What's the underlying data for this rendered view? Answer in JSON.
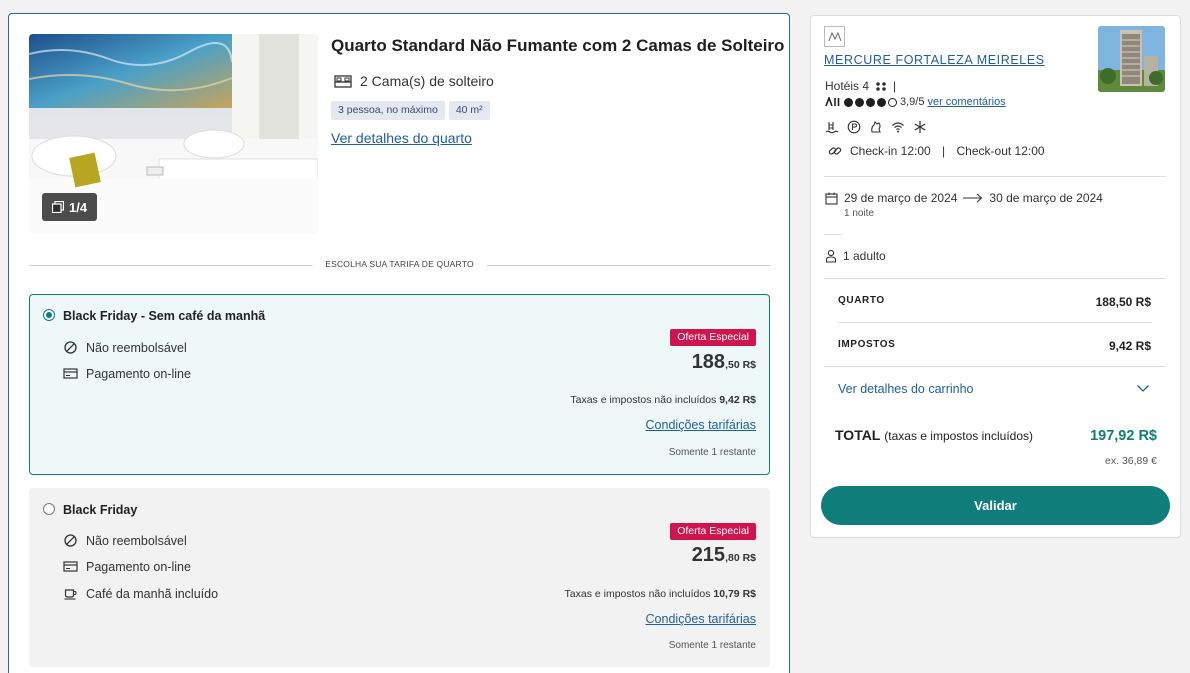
{
  "room": {
    "title": "Quarto Standard Não Fumante com 2 Camas de Solteiro",
    "beds": "2 Cama(s) de solteiro",
    "tags": [
      "3 pessoa, no máximo",
      "40 m²"
    ],
    "details_link": "Ver detalhes do quarto",
    "photo_counter": "1/4",
    "choose_rate_label": "ESCOLHA SUA TARIFA DE QUARTO"
  },
  "rates": [
    {
      "name": "Black Friday - Sem café da manhã",
      "selected": true,
      "features": [
        {
          "icon": "non-refundable-icon",
          "label": "Não reembolsável"
        },
        {
          "icon": "credit-card-icon",
          "label": "Pagamento on-line"
        }
      ],
      "badge": "Oferta Especial",
      "price_int": "188",
      "price_dec": ",50 R$",
      "tax_prefix": "Taxas e impostos não incluídos ",
      "tax_value": "9,42 R$",
      "conditions_link": "Condições tarifárias",
      "remaining": "Somente 1 restante"
    },
    {
      "name": "Black Friday",
      "selected": false,
      "features": [
        {
          "icon": "non-refundable-icon",
          "label": "Não reembolsável"
        },
        {
          "icon": "credit-card-icon",
          "label": "Pagamento on-line"
        },
        {
          "icon": "coffee-cup-icon",
          "label": "Café da manhã incluído"
        }
      ],
      "badge": "Oferta Especial",
      "price_int": "215",
      "price_dec": ",80 R$",
      "tax_prefix": "Taxas e impostos não incluídos ",
      "tax_value": "10,79 R$",
      "conditions_link": "Condições tarifárias",
      "remaining": "Somente 1 restante"
    }
  ],
  "summary": {
    "hotel_name": "MERCURE FORTALEZA MEIRELES",
    "category": "Hotéis 4",
    "rating": "3,9/5",
    "reviews_link": "ver comentários",
    "checkin": "Check-in 12:00",
    "checkout": "Check-out 12:00",
    "date_from": "29 de março de 2024",
    "date_to": "30 de março de 2024",
    "nights": "1 noite",
    "guests": "1 adulto",
    "room_label": "QUARTO",
    "room_value": "188,50 R$",
    "tax_label": "IMPOSTOS",
    "tax_value": "9,42 R$",
    "cart_link": "Ver detalhes do carrinho",
    "total_label": "TOTAL",
    "total_note": "(taxas e impostos incluídos)",
    "total_value": "197,92 R$",
    "total_eur": "ex. 36,89 €",
    "validate_button": "Validar"
  },
  "colors": {
    "accent": "#0f7d7a",
    "link": "#1f5fa0",
    "offer": "#d0144e",
    "panel_border": "#2a64b3"
  }
}
